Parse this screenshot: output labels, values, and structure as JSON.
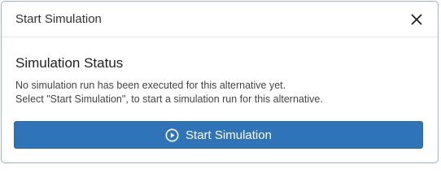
{
  "dialog": {
    "title": "Start Simulation",
    "close_icon": "close-icon"
  },
  "body": {
    "section_title": "Simulation Status",
    "lines": [
      "No simulation run has been executed for this alternative yet.",
      "Select \"Start Simulation\", to start a simulation run for this alternative."
    ]
  },
  "actions": {
    "start_label": "Start Simulation",
    "start_icon": "play-circle-icon"
  },
  "colors": {
    "primary": "#2f74b9",
    "border": "#9fb1c4"
  }
}
